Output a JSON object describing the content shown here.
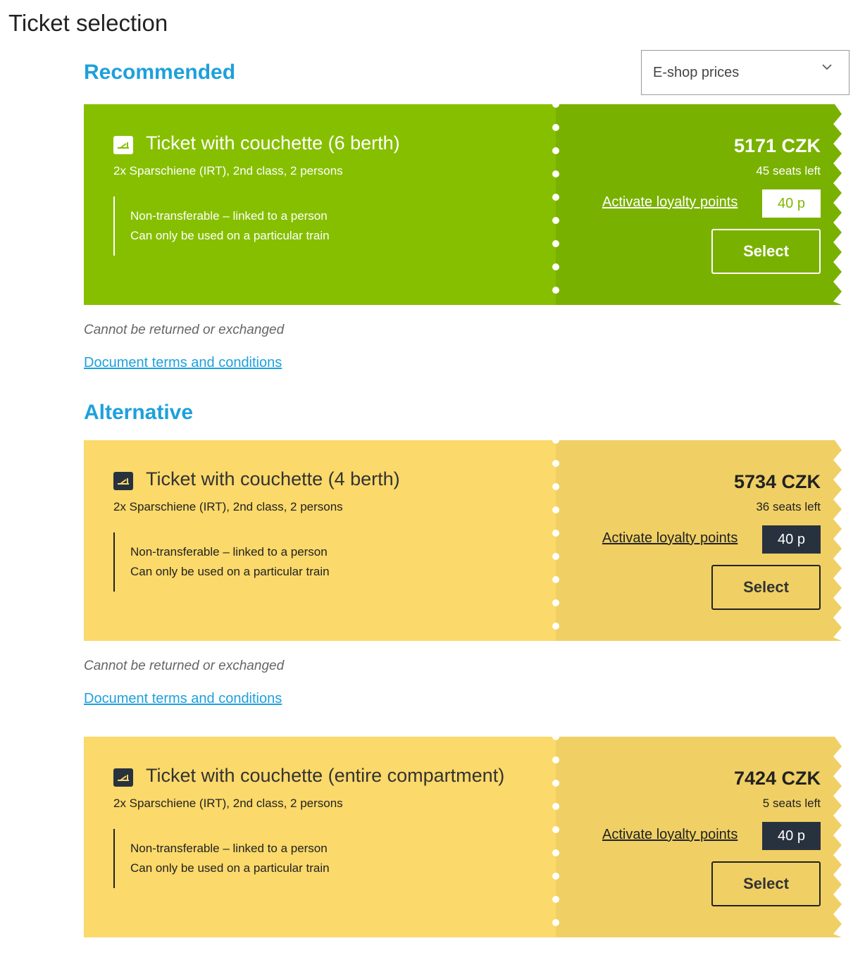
{
  "page": {
    "title": "Ticket selection"
  },
  "sections": {
    "recommended": "Recommended",
    "alternative": "Alternative"
  },
  "price_filter": {
    "value": "E-shop prices",
    "icon": "chevron-down-icon"
  },
  "colors": {
    "accent_blue": "#1ea0dc",
    "green_light": "#86bf00",
    "green_dark": "#79b100",
    "yellow_light": "#fbd96a",
    "yellow_dark": "#f0d064",
    "points_dark": "#28323f"
  },
  "tickets": [
    {
      "name": "Ticket with couchette (6 berth)",
      "subtitle": "2x Sparschiene (IRT), 2nd class, 2 persons",
      "conditions": [
        "Non-transferable – linked to a person",
        "Can only be used on a particular train"
      ],
      "price": "5171 CZK",
      "seats": "45 seats left",
      "loyalty_label": "Activate loyalty points",
      "points": "40 p",
      "select_label": "Select",
      "note": "Cannot be returned or exchanged",
      "terms": "Document terms and conditions",
      "icon": "couchette-icon"
    },
    {
      "name": "Ticket with couchette (4 berth)",
      "subtitle": "2x Sparschiene (IRT), 2nd class, 2 persons",
      "conditions": [
        "Non-transferable – linked to a person",
        "Can only be used on a particular train"
      ],
      "price": "5734 CZK",
      "seats": "36 seats left",
      "loyalty_label": "Activate loyalty points",
      "points": "40 p",
      "select_label": "Select",
      "note": "Cannot be returned or exchanged",
      "terms": "Document terms and conditions",
      "icon": "couchette-icon"
    },
    {
      "name": "Ticket with couchette (entire compartment)",
      "subtitle": "2x Sparschiene (IRT), 2nd class, 2 persons",
      "conditions": [
        "Non-transferable – linked to a person",
        "Can only be used on a particular train"
      ],
      "price": "7424 CZK",
      "seats": "5 seats left",
      "loyalty_label": "Activate loyalty points",
      "points": "40 p",
      "select_label": "Select",
      "icon": "couchette-icon"
    }
  ]
}
